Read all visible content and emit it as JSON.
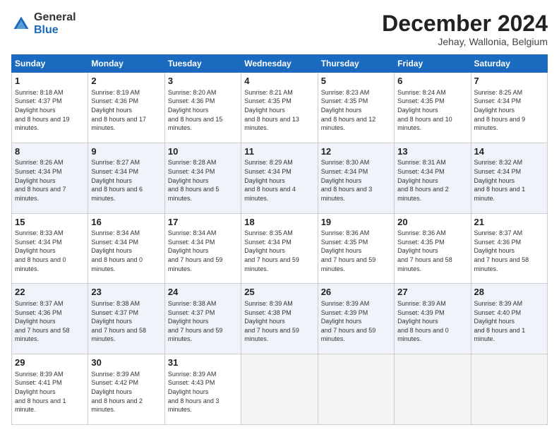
{
  "logo": {
    "general": "General",
    "blue": "Blue"
  },
  "header": {
    "month_year": "December 2024",
    "subtitle": "Jehay, Wallonia, Belgium"
  },
  "days_of_week": [
    "Sunday",
    "Monday",
    "Tuesday",
    "Wednesday",
    "Thursday",
    "Friday",
    "Saturday"
  ],
  "weeks": [
    [
      {
        "day": 1,
        "sunrise": "8:18 AM",
        "sunset": "4:37 PM",
        "daylight": "8 hours and 19 minutes."
      },
      {
        "day": 2,
        "sunrise": "8:19 AM",
        "sunset": "4:36 PM",
        "daylight": "8 hours and 17 minutes."
      },
      {
        "day": 3,
        "sunrise": "8:20 AM",
        "sunset": "4:36 PM",
        "daylight": "8 hours and 15 minutes."
      },
      {
        "day": 4,
        "sunrise": "8:21 AM",
        "sunset": "4:35 PM",
        "daylight": "8 hours and 13 minutes."
      },
      {
        "day": 5,
        "sunrise": "8:23 AM",
        "sunset": "4:35 PM",
        "daylight": "8 hours and 12 minutes."
      },
      {
        "day": 6,
        "sunrise": "8:24 AM",
        "sunset": "4:35 PM",
        "daylight": "8 hours and 10 minutes."
      },
      {
        "day": 7,
        "sunrise": "8:25 AM",
        "sunset": "4:34 PM",
        "daylight": "8 hours and 9 minutes."
      }
    ],
    [
      {
        "day": 8,
        "sunrise": "8:26 AM",
        "sunset": "4:34 PM",
        "daylight": "8 hours and 7 minutes."
      },
      {
        "day": 9,
        "sunrise": "8:27 AM",
        "sunset": "4:34 PM",
        "daylight": "8 hours and 6 minutes."
      },
      {
        "day": 10,
        "sunrise": "8:28 AM",
        "sunset": "4:34 PM",
        "daylight": "8 hours and 5 minutes."
      },
      {
        "day": 11,
        "sunrise": "8:29 AM",
        "sunset": "4:34 PM",
        "daylight": "8 hours and 4 minutes."
      },
      {
        "day": 12,
        "sunrise": "8:30 AM",
        "sunset": "4:34 PM",
        "daylight": "8 hours and 3 minutes."
      },
      {
        "day": 13,
        "sunrise": "8:31 AM",
        "sunset": "4:34 PM",
        "daylight": "8 hours and 2 minutes."
      },
      {
        "day": 14,
        "sunrise": "8:32 AM",
        "sunset": "4:34 PM",
        "daylight": "8 hours and 1 minute."
      }
    ],
    [
      {
        "day": 15,
        "sunrise": "8:33 AM",
        "sunset": "4:34 PM",
        "daylight": "8 hours and 0 minutes."
      },
      {
        "day": 16,
        "sunrise": "8:34 AM",
        "sunset": "4:34 PM",
        "daylight": "8 hours and 0 minutes."
      },
      {
        "day": 17,
        "sunrise": "8:34 AM",
        "sunset": "4:34 PM",
        "daylight": "7 hours and 59 minutes."
      },
      {
        "day": 18,
        "sunrise": "8:35 AM",
        "sunset": "4:34 PM",
        "daylight": "7 hours and 59 minutes."
      },
      {
        "day": 19,
        "sunrise": "8:36 AM",
        "sunset": "4:35 PM",
        "daylight": "7 hours and 59 minutes."
      },
      {
        "day": 20,
        "sunrise": "8:36 AM",
        "sunset": "4:35 PM",
        "daylight": "7 hours and 58 minutes."
      },
      {
        "day": 21,
        "sunrise": "8:37 AM",
        "sunset": "4:36 PM",
        "daylight": "7 hours and 58 minutes."
      }
    ],
    [
      {
        "day": 22,
        "sunrise": "8:37 AM",
        "sunset": "4:36 PM",
        "daylight": "7 hours and 58 minutes."
      },
      {
        "day": 23,
        "sunrise": "8:38 AM",
        "sunset": "4:37 PM",
        "daylight": "7 hours and 58 minutes."
      },
      {
        "day": 24,
        "sunrise": "8:38 AM",
        "sunset": "4:37 PM",
        "daylight": "7 hours and 59 minutes."
      },
      {
        "day": 25,
        "sunrise": "8:39 AM",
        "sunset": "4:38 PM",
        "daylight": "7 hours and 59 minutes."
      },
      {
        "day": 26,
        "sunrise": "8:39 AM",
        "sunset": "4:39 PM",
        "daylight": "7 hours and 59 minutes."
      },
      {
        "day": 27,
        "sunrise": "8:39 AM",
        "sunset": "4:39 PM",
        "daylight": "8 hours and 0 minutes."
      },
      {
        "day": 28,
        "sunrise": "8:39 AM",
        "sunset": "4:40 PM",
        "daylight": "8 hours and 1 minute."
      }
    ],
    [
      {
        "day": 29,
        "sunrise": "8:39 AM",
        "sunset": "4:41 PM",
        "daylight": "8 hours and 1 minute."
      },
      {
        "day": 30,
        "sunrise": "8:39 AM",
        "sunset": "4:42 PM",
        "daylight": "8 hours and 2 minutes."
      },
      {
        "day": 31,
        "sunrise": "8:39 AM",
        "sunset": "4:43 PM",
        "daylight": "8 hours and 3 minutes."
      },
      null,
      null,
      null,
      null
    ]
  ]
}
